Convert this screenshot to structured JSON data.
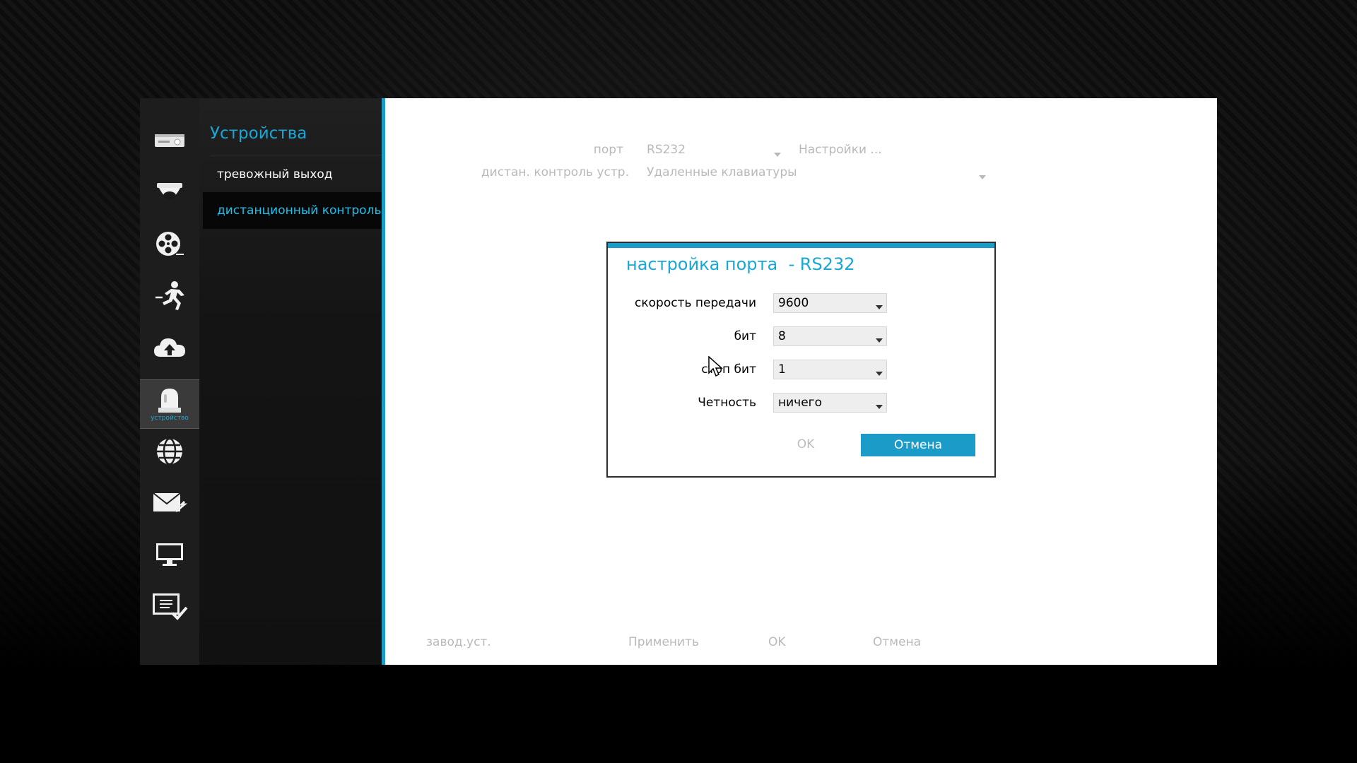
{
  "colors": {
    "accent": "#1a9bc8",
    "muted_text": "#b9b9b9"
  },
  "nav": {
    "icons": [
      {
        "name": "dvr-icon"
      },
      {
        "name": "dome-camera-icon"
      },
      {
        "name": "film-reel-icon"
      },
      {
        "name": "running-man-icon"
      },
      {
        "name": "cloud-upload-icon"
      },
      {
        "name": "alarm-beacon-icon",
        "caption": "устройство",
        "active": true
      },
      {
        "name": "globe-icon"
      },
      {
        "name": "mail-icon"
      },
      {
        "name": "monitor-icon"
      },
      {
        "name": "checklist-icon"
      }
    ]
  },
  "submenu": {
    "title": "Устройства",
    "items": [
      {
        "label": "тревожный выход"
      },
      {
        "label": "дистанционный контроль",
        "active": true
      }
    ]
  },
  "main": {
    "port_label": "порт",
    "port_value": "RS232",
    "settings_link": "Настройки ...",
    "remote_label": "дистан. контроль устр.",
    "remote_value": "Удаленные клавиатуры",
    "footer": {
      "factory": "завод.уст.",
      "apply": "Применить",
      "ok": "OK",
      "cancel": "Отмена"
    }
  },
  "dialog": {
    "title": "настройка порта  - RS232",
    "fields": [
      {
        "label": "скорость передачи",
        "value": "9600"
      },
      {
        "label": "бит",
        "value": "8"
      },
      {
        "label": "стоп бит",
        "value": "1"
      },
      {
        "label": "Четность",
        "value": "ничего"
      }
    ],
    "ok": "OK",
    "cancel": "Отмена"
  }
}
